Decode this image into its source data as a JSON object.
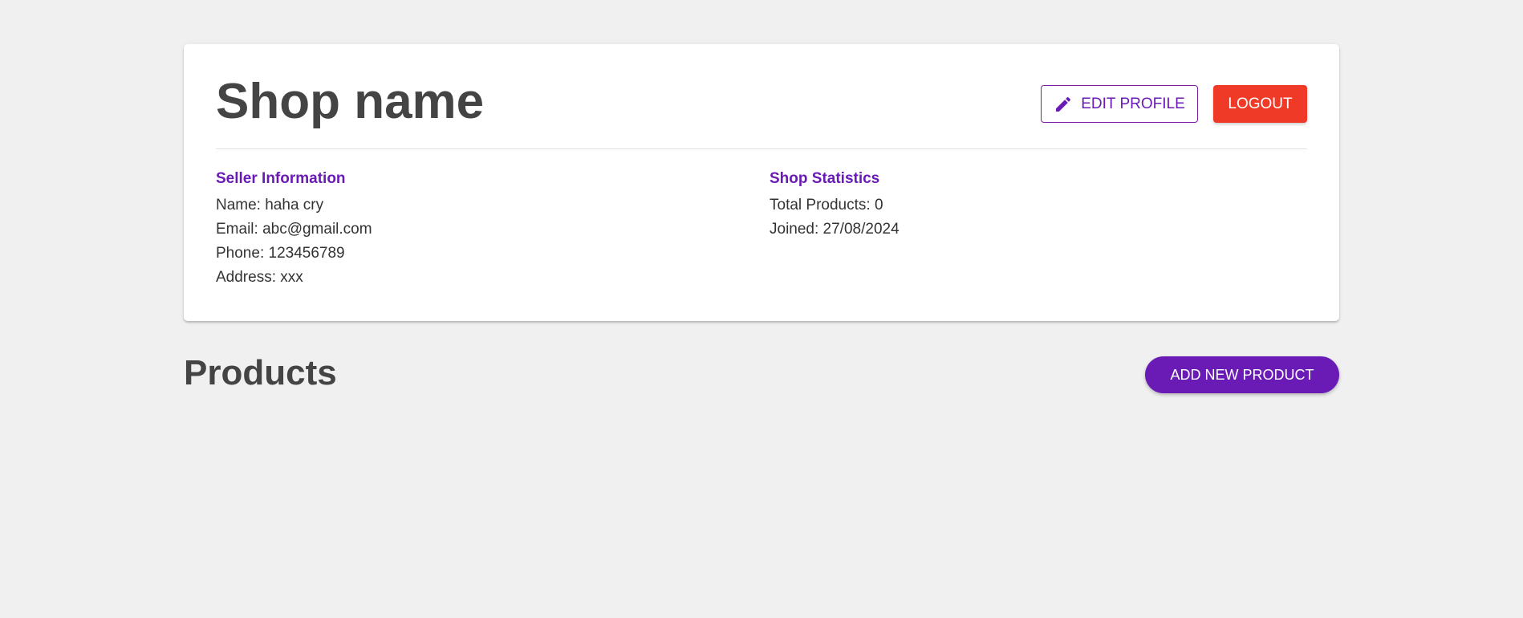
{
  "shop": {
    "title": "Shop name",
    "edit_profile_label": "EDIT PROFILE",
    "edit_icon": "pencil-icon",
    "logout_label": "LOGOUT"
  },
  "seller_info": {
    "heading": "Seller Information",
    "name": "Name: haha cry",
    "email": "Email: abc@gmail.com",
    "phone": "Phone: 123456789",
    "address": "Address: xxx"
  },
  "shop_stats": {
    "heading": "Shop Statistics",
    "total_products": "Total Products: 0",
    "joined": "Joined: 27/08/2024"
  },
  "products": {
    "heading": "Products",
    "add_label": "ADD NEW PRODUCT"
  },
  "colors": {
    "accent": "#6a1bb5",
    "logout": "#ee3a26",
    "background": "#f0f0f0"
  }
}
